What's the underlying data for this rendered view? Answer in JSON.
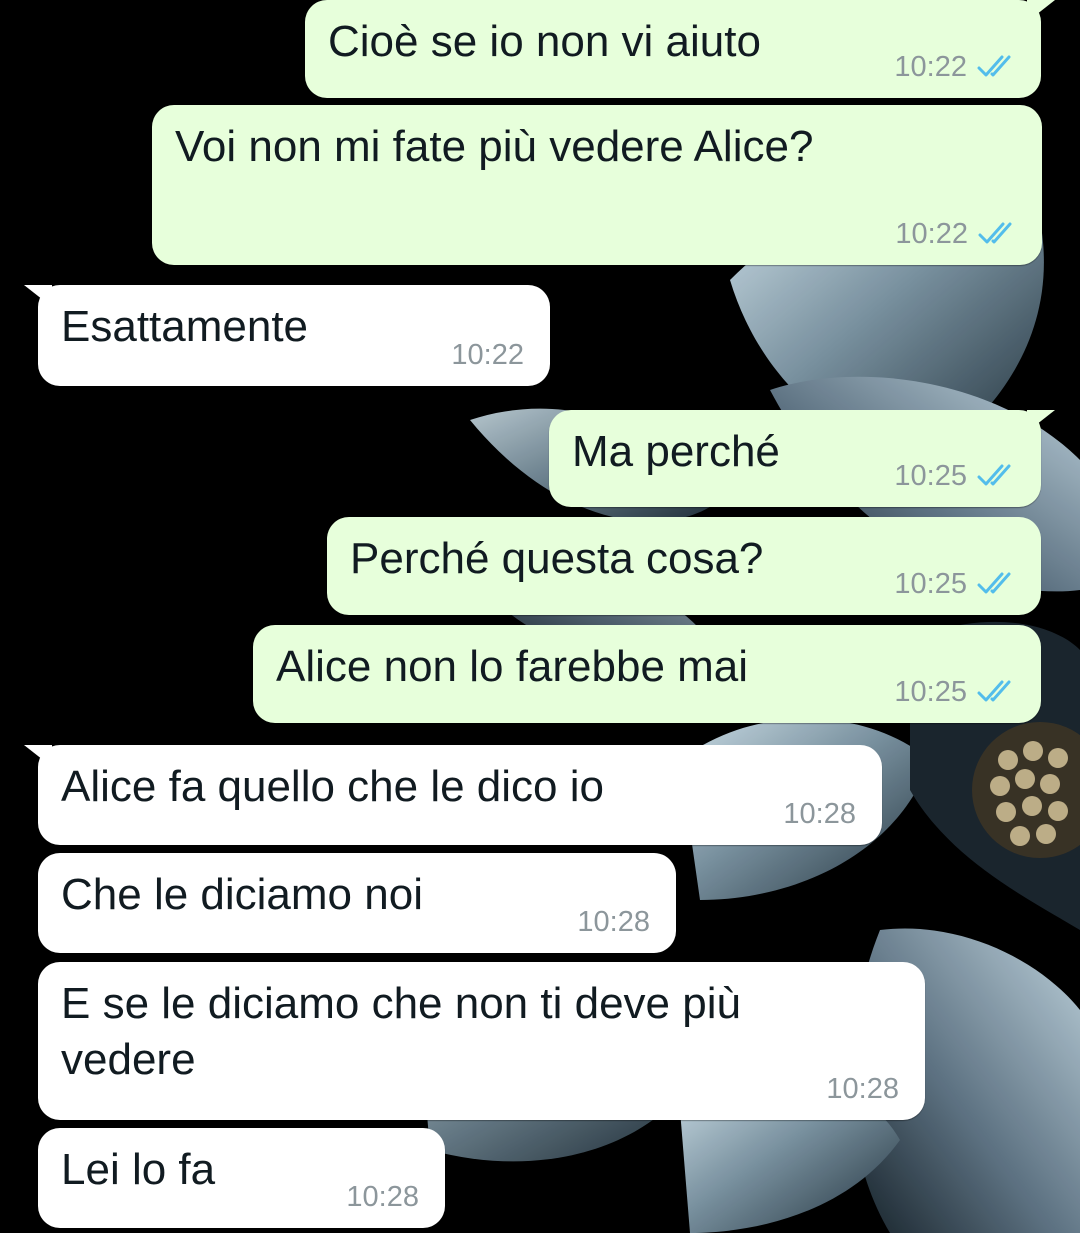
{
  "conversation": {
    "messages": [
      {
        "direction": "outgoing",
        "text": "Cioè se io non vi aiuto",
        "time": "10:22",
        "status": "read"
      },
      {
        "direction": "outgoing",
        "text": "Voi non mi fate più vedere Alice?",
        "time": "10:22",
        "status": "read"
      },
      {
        "direction": "incoming",
        "text": "Esattamente",
        "time": "10:22"
      },
      {
        "direction": "outgoing",
        "text": "Ma perché",
        "time": "10:25",
        "status": "read"
      },
      {
        "direction": "outgoing",
        "text": "Perché questa cosa?",
        "time": "10:25",
        "status": "read"
      },
      {
        "direction": "outgoing",
        "text": "Alice non lo farebbe mai",
        "time": "10:25",
        "status": "read"
      },
      {
        "direction": "incoming",
        "text": "Alice fa quello che le dico io",
        "time": "10:28"
      },
      {
        "direction": "incoming",
        "text": "Che le diciamo noi",
        "time": "10:28"
      },
      {
        "direction": "incoming",
        "text": "E se le diciamo che non ti deve più\nvedere",
        "time": "10:28"
      },
      {
        "direction": "incoming",
        "text": "Lei lo fa",
        "time": "10:28"
      }
    ]
  },
  "colors": {
    "outgoing_bubble": "#e7ffdb",
    "incoming_bubble": "#ffffff",
    "read_check": "#53bdeb",
    "timestamp": "#8c969b",
    "wallpaper": "#000000"
  },
  "icons": {
    "read_receipt": "double-check-icon"
  }
}
